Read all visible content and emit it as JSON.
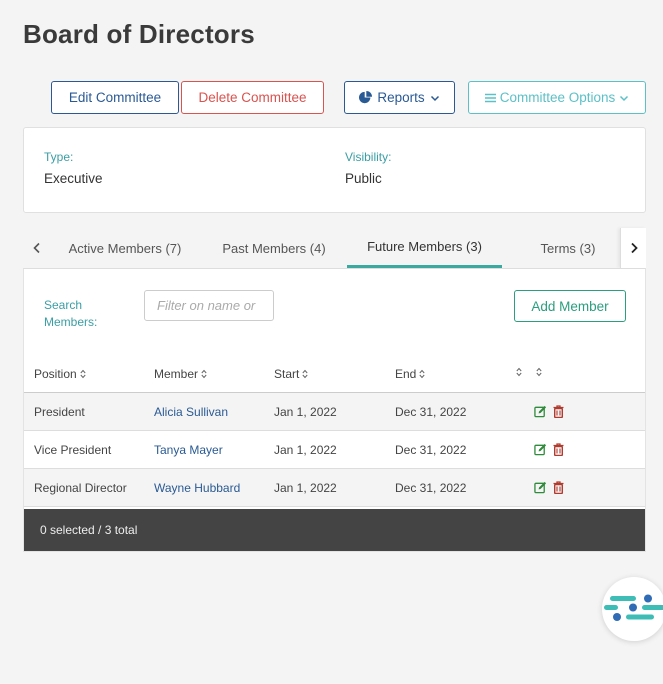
{
  "page": {
    "title": "Board of Directors"
  },
  "actions": {
    "edit": "Edit Committee",
    "delete": "Delete Committee",
    "reports": "Reports",
    "options": "Committee Options"
  },
  "info": {
    "type_label": "Type:",
    "type_value": "Executive",
    "visibility_label": "Visibility:",
    "visibility_value": "Public"
  },
  "tabs": [
    {
      "label": "Active Members (7)"
    },
    {
      "label": "Past Members (4)"
    },
    {
      "label": "Future Members (3)",
      "active": true
    },
    {
      "label": "Terms (3)"
    }
  ],
  "search": {
    "label": "Search Members:",
    "placeholder": "Filter on name or",
    "value": ""
  },
  "add_member": "Add Member",
  "table": {
    "headers": [
      "Position",
      "Member",
      "Start",
      "End"
    ],
    "rows": [
      {
        "position": "President",
        "member": "Alicia Sullivan",
        "start": "Jan 1, 2022",
        "end": "Dec 31, 2022"
      },
      {
        "position": "Vice President",
        "member": "Tanya Mayer",
        "start": "Jan 1, 2022",
        "end": "Dec 31, 2022"
      },
      {
        "position": "Regional Director",
        "member": "Wayne Hubbard",
        "start": "Jan 1, 2022",
        "end": "Dec 31, 2022"
      }
    ]
  },
  "footer": {
    "selection": "0 selected / 3 total"
  },
  "colors": {
    "primary": "#2a5a94",
    "danger": "#d9534f",
    "teal": "#5bc0c7",
    "green": "#2b9e7d",
    "edit_icon": "#2e8b3a",
    "delete_icon": "#b03a2e"
  }
}
